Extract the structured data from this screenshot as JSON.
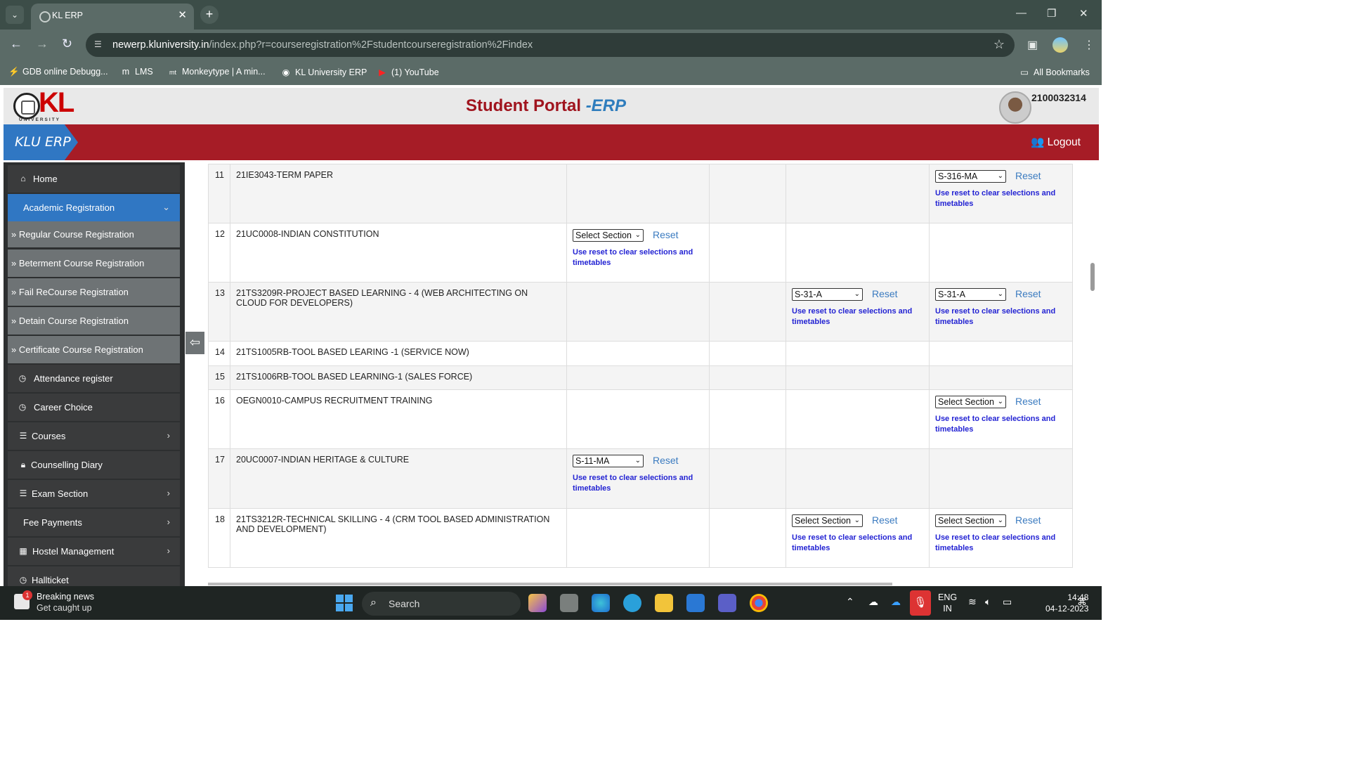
{
  "browser": {
    "tab_title": "KL ERP",
    "url_host": "newerp.kluniversity.in",
    "url_path": "/index.php?r=courseregistration%2Fstudentcourseregistration%2Findex",
    "bookmarks": [
      {
        "label": "GDB online Debugg...",
        "icon": "bolt-icon"
      },
      {
        "label": "LMS",
        "icon": "moodle-icon"
      },
      {
        "label": "Monkeytype | A min...",
        "icon": "monkeytype-icon"
      },
      {
        "label": "KL University ERP",
        "icon": "globe-icon"
      },
      {
        "label": "(1) YouTube",
        "icon": "youtube-icon"
      }
    ],
    "all_bookmarks": "All Bookmarks"
  },
  "portal": {
    "title_main": "Student Portal",
    "title_suffix": "-ERP",
    "logo_text": "KL",
    "logo_sub": "UNIVERSITY",
    "user_id": "2100032314",
    "brand": "KLU ERP",
    "logout": "Logout"
  },
  "sidebar": {
    "items": [
      {
        "label": "Home",
        "icon": "home-icon",
        "chevron": ""
      },
      {
        "label": "Academic Registration",
        "icon": "",
        "chevron": "⌄"
      },
      {
        "label": "» Regular Course Registration"
      },
      {
        "label": "» Beterment Course Registration"
      },
      {
        "label": "» Fail ReCourse Registration"
      },
      {
        "label": "» Detain Course Registration"
      },
      {
        "label": "» Certificate Course Registration"
      },
      {
        "label": "Attendance register",
        "icon": "clock-icon"
      },
      {
        "label": "Career Choice",
        "icon": "clock-icon"
      },
      {
        "label": "Courses",
        "icon": "list-icon",
        "chevron": "›"
      },
      {
        "label": "Counselling Diary",
        "icon": "lock-icon"
      },
      {
        "label": "Exam Section",
        "icon": "list-icon",
        "chevron": "›"
      },
      {
        "label": "Fee Payments",
        "icon": "",
        "chevron": "›"
      },
      {
        "label": "Hostel Management",
        "icon": "building-icon",
        "chevron": "›"
      },
      {
        "label": "Hallticket",
        "icon": "clock-icon"
      }
    ]
  },
  "courses": {
    "reset_label": "Reset",
    "hint": "Use reset to clear selections and timetables",
    "rows": [
      {
        "sn": "11",
        "course": "21IE3043-TERM PAPER",
        "cells": [
          "",
          "",
          "",
          "S-316-MA"
        ]
      },
      {
        "sn": "12",
        "course": "21UC0008-INDIAN CONSTITUTION",
        "cells": [
          "Select Section",
          "",
          "",
          ""
        ]
      },
      {
        "sn": "13",
        "course": "21TS3209R-PROJECT BASED LEARNING - 4 (WEB ARCHITECTING ON CLOUD FOR DEVELOPERS)",
        "cells": [
          "",
          "",
          "S-31-A",
          "S-31-A"
        ]
      },
      {
        "sn": "14",
        "course": "21TS1005RB-TOOL BASED LEARING -1 (SERVICE NOW)",
        "cells": [
          "",
          "",
          "",
          ""
        ]
      },
      {
        "sn": "15",
        "course": "21TS1006RB-TOOL BASED LEARNING-1 (SALES FORCE)",
        "cells": [
          "",
          "",
          "",
          ""
        ]
      },
      {
        "sn": "16",
        "course": "OEGN0010-CAMPUS RECRUITMENT TRAINING",
        "cells": [
          "",
          "",
          "",
          "Select Section"
        ]
      },
      {
        "sn": "17",
        "course": "20UC0007-INDIAN HERITAGE & CULTURE",
        "cells": [
          "S-11-MA",
          "",
          "",
          ""
        ]
      },
      {
        "sn": "18",
        "course": "21TS3212R-TECHNICAL SKILLING - 4 (CRM TOOL BASED ADMINISTRATION AND DEVELOPMENT)",
        "cells": [
          "",
          "",
          "Select Section",
          "Select Section"
        ]
      }
    ]
  },
  "taskbar": {
    "news_title": "Breaking news",
    "news_sub": "Get caught up",
    "news_badge": "1",
    "search": "Search",
    "lang1": "ENG",
    "lang2": "IN",
    "time": "14:48",
    "date": "04-12-2023"
  },
  "colors": {
    "brand_red": "#a61c26",
    "brand_blue": "#3077c3",
    "hint_blue": "#2323d3"
  }
}
